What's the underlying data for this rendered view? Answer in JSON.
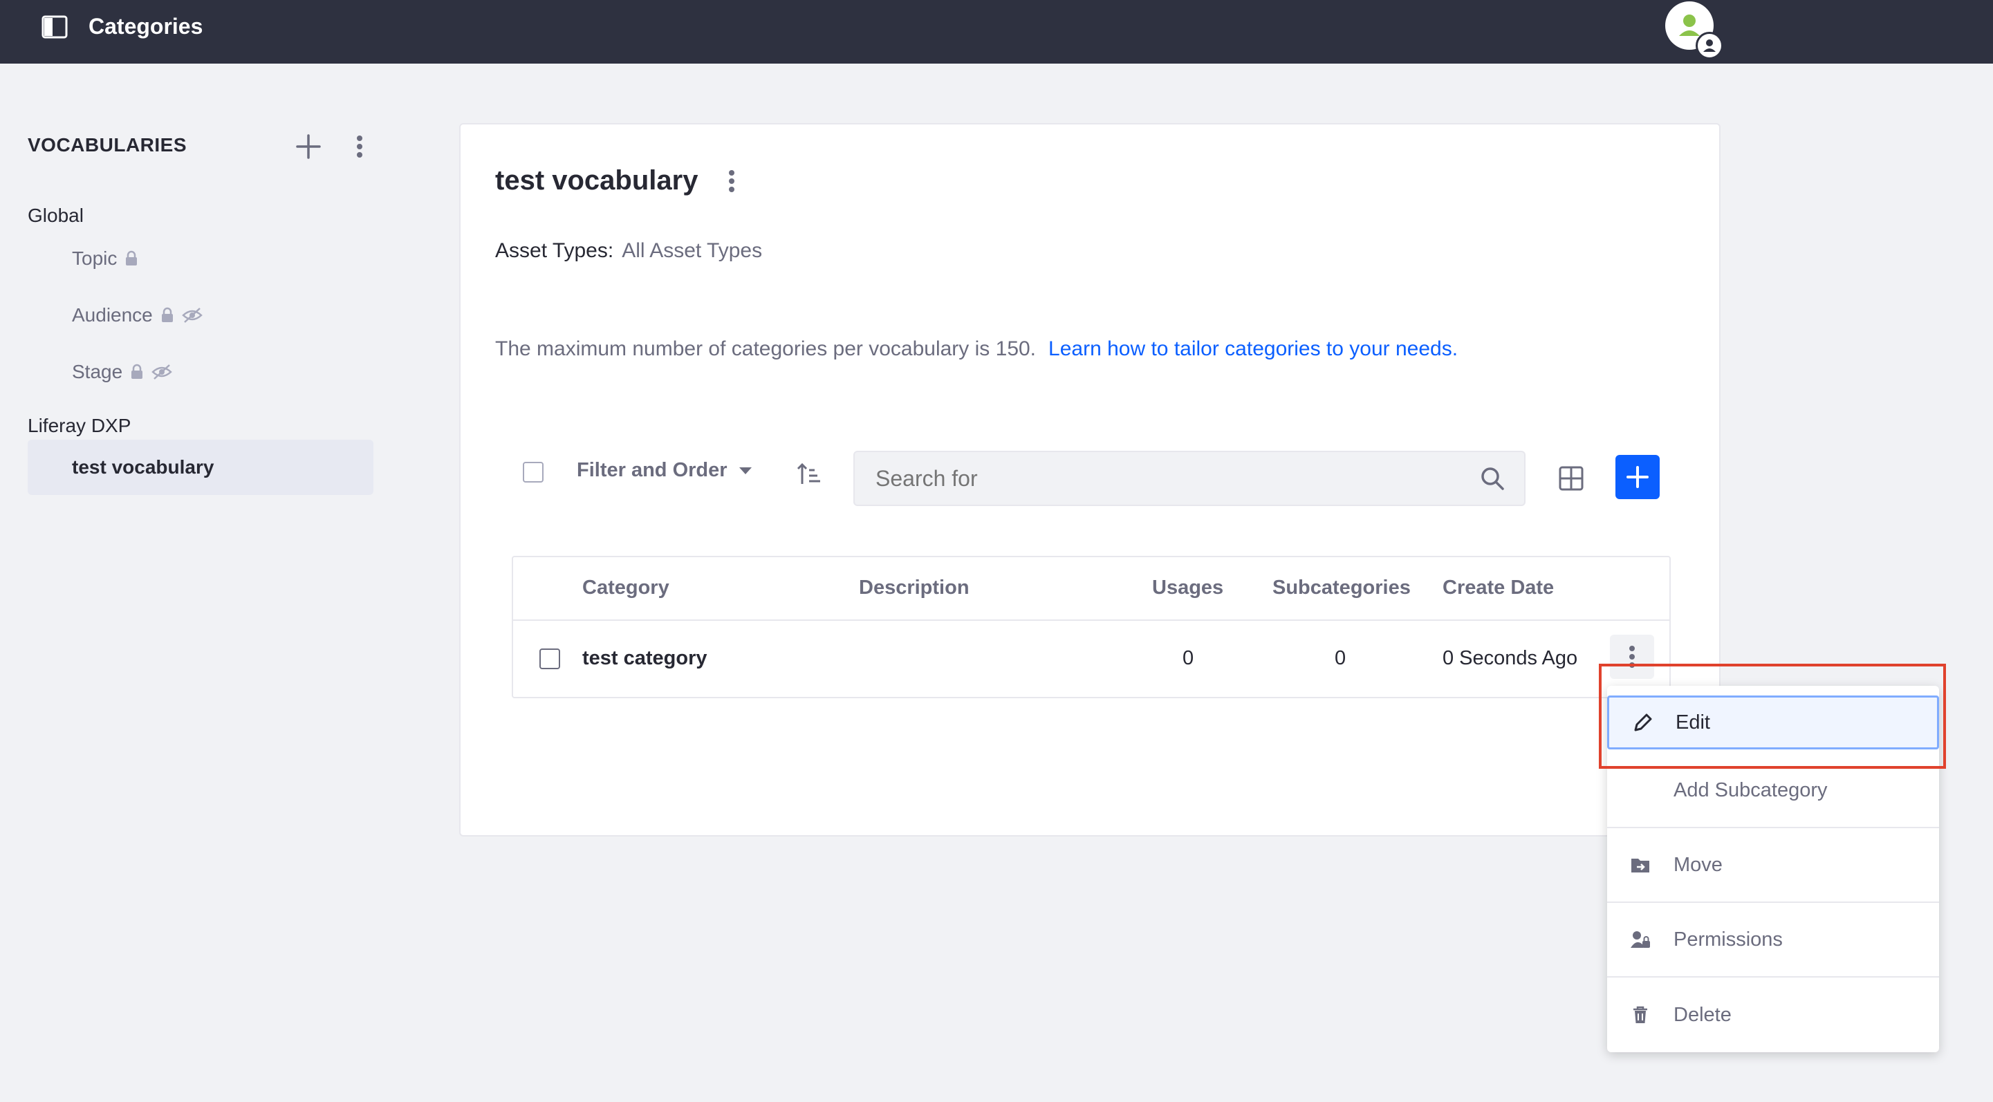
{
  "header": {
    "title": "Categories"
  },
  "sidebar": {
    "heading": "VOCABULARIES",
    "groups": [
      {
        "label": "Global",
        "items": [
          {
            "label": "Topic"
          },
          {
            "label": "Audience"
          },
          {
            "label": "Stage"
          }
        ]
      },
      {
        "label": "Liferay DXP",
        "items": [
          {
            "label": "test vocabulary"
          }
        ]
      }
    ]
  },
  "main": {
    "vocabulary_title": "test vocabulary",
    "asset_types_label": "Asset Types:",
    "asset_types_value": "All Asset Types",
    "notice_text": "The maximum number of categories per vocabulary is 150.",
    "notice_link": "Learn how to tailor categories to your needs.",
    "toolbar": {
      "filter_order_label": "Filter and Order",
      "search_placeholder": "Search for"
    },
    "table": {
      "columns": [
        "Category",
        "Description",
        "Usages",
        "Subcategories",
        "Create Date"
      ],
      "rows": [
        {
          "category": "test category",
          "description": "",
          "usages": "0",
          "subcategories": "0",
          "create_date": "0 Seconds Ago"
        }
      ]
    }
  },
  "dropdown": {
    "items": [
      {
        "label": "Edit",
        "icon": "pencil-icon"
      },
      {
        "label": "Add Subcategory",
        "icon": ""
      },
      {
        "label": "Move",
        "icon": "folder-move-icon"
      },
      {
        "label": "Permissions",
        "icon": "user-lock-icon"
      },
      {
        "label": "Delete",
        "icon": "trash-icon"
      }
    ]
  },
  "colors": {
    "header_bg": "#2e3140",
    "accent": "#0b5fff",
    "highlight": "#e0422d"
  }
}
